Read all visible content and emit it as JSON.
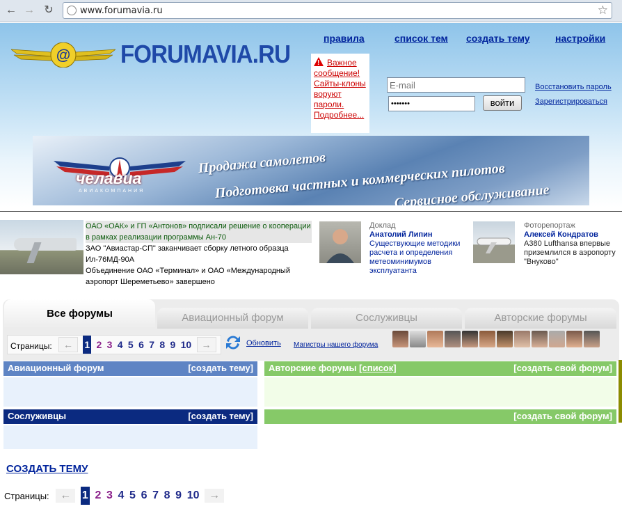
{
  "browser": {
    "url": "www.forumavia.ru",
    "back_icon": "back-arrow-icon",
    "forward_icon": "forward-arrow-icon",
    "reload_icon": "reload-icon",
    "star_icon": "star-icon"
  },
  "header": {
    "site_name": "FORUMAVIA.RU",
    "nav": [
      "правила",
      "список тем",
      "создать тему",
      "настройки"
    ],
    "alert": {
      "title": "Важное сообщение!",
      "body": "Сайты-клоны воруют пароли.",
      "more": "Подробнее..."
    },
    "login": {
      "email_placeholder": "E-mail",
      "password_value": "•••••••",
      "submit": "войти"
    },
    "restore_password": "Восстановить пароль",
    "register": "Зарегистрироваться"
  },
  "banner": {
    "brand_name": "челавиа",
    "brand_sub": "АВИАКОМПАНИЯ",
    "lines": [
      "Продажа самолетов",
      "Подготовка частных и коммерческих пилотов",
      "Сервисное обслуживание"
    ]
  },
  "news": {
    "items": [
      "ОАО «ОАК» и ГП «Антонов» подписали решение о кооперации в рамках реализации программы Ан-70",
      "ЗАО \"Авиастар-СП\" заканчивает сборку летного образца Ил-76МД-90А",
      "Объединение ОАО «Терминал» и ОАО «Международный аэропорт Шереметьево» завершено"
    ]
  },
  "features": [
    {
      "category": "Доклад",
      "author": "Анатолий Липин",
      "title": "Существующие методики расчета и определения метеоминимумов эксплуатанта"
    },
    {
      "category": "Фоторепортаж",
      "author": "Алексей Кондратов",
      "title": "A380 Lufthansa впервые приземлился в аэропорту \"Внуково\""
    }
  ],
  "tabs": [
    "Все форумы",
    "Авиационный форум",
    "Сослуживцы",
    "Авторские форумы"
  ],
  "pager": {
    "label": "Страницы:",
    "prev": "←",
    "next": "→",
    "pages": [
      "1",
      "2",
      "3",
      "4",
      "5",
      "6",
      "7",
      "8",
      "9",
      "10"
    ],
    "current": "1"
  },
  "toolbar": {
    "refresh": "Обновить",
    "masters": "Магистры нашего форума"
  },
  "boxes": {
    "aviation": {
      "title": "Авиационный форум",
      "action": "[создать тему]"
    },
    "author": {
      "title": "Авторские форумы",
      "list_link": "[список]",
      "action": "[создать свой форум]"
    },
    "colleagues": {
      "title": "Сослуживцы",
      "action": "[создать тему]"
    },
    "author2": {
      "action": "[создать свой форум]"
    }
  },
  "create_topic": "СОЗДАТЬ ТЕМУ",
  "colors": {
    "nav_link": "#00239c",
    "aviation_head": "#5e84c4",
    "colleagues_head": "#0b2a80",
    "author_head": "#86c968",
    "alert": "#cc0000"
  }
}
